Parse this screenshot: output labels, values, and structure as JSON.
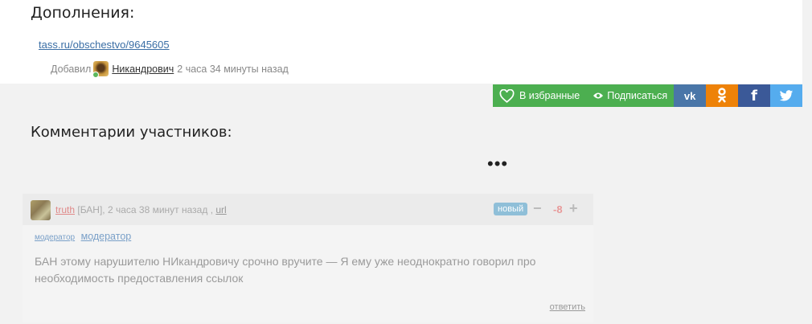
{
  "article": {
    "additions_title": "Дополнения:",
    "source_link": "tass.ru/obschestvo/9645605",
    "added_label": "Добавил",
    "author": "Никандрович",
    "added_time": "2 часа 34 минуты назад"
  },
  "actions": {
    "favorite_label": "В избранные",
    "subscribe_label": "Подписаться",
    "social": [
      "vk-icon",
      "ok-icon",
      "facebook-icon",
      "twitter-icon"
    ],
    "colors": {
      "green": "#4caf50",
      "vk": "#4a76a8",
      "ok": "#ee8208",
      "fb": "#3b5998",
      "tw": "#55acee"
    }
  },
  "comments": {
    "title": "Комментарии участников:",
    "more": "•••",
    "items": [
      {
        "author": "truth",
        "meta": "[БАН], 2 часа 38 минут назад ,",
        "url_label": "url",
        "badge": "новый",
        "minus": "−",
        "score": "-8",
        "plus": "+",
        "mod_img_alt": "модератор",
        "mod_label": "модератор",
        "text": "БАН этому нарушителю НИкандровичу срочно вручите — Я ему уже неоднократно говорил про необходимость предоставления ссылок",
        "reply_label": "ответить"
      }
    ]
  }
}
